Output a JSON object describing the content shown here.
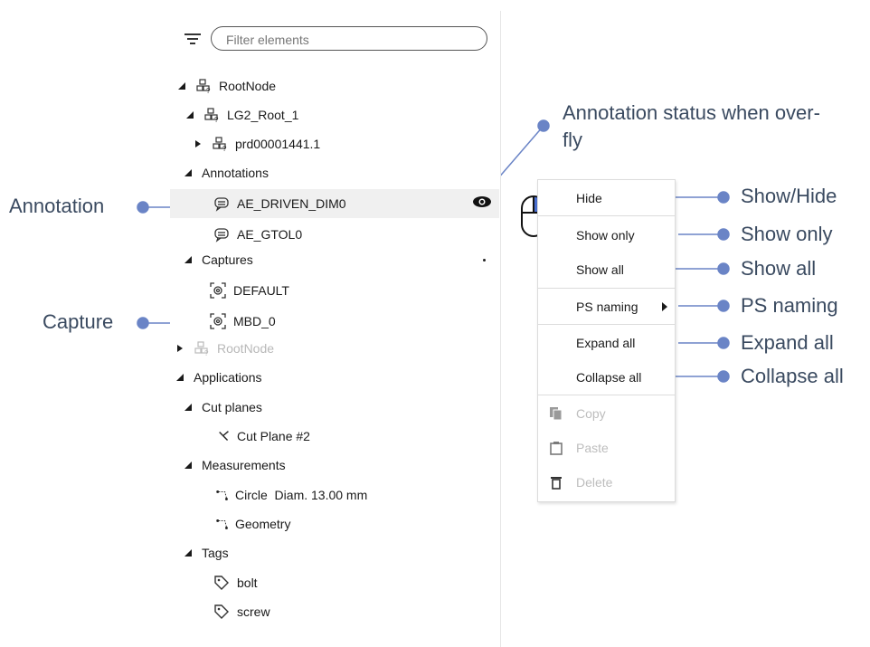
{
  "filter": {
    "placeholder": "Filter elements"
  },
  "tree": {
    "root_node": "RootNode",
    "lg2_root": "LG2_Root_1",
    "prd": "prd00001441.1",
    "annotations": "Annotations",
    "ann_driven": "AE_DRIVEN_DIM0",
    "ann_gtol": "AE_GTOL0",
    "captures": "Captures",
    "cap_default": "DEFAULT",
    "cap_mbd": "MBD_0",
    "root_node_2": "RootNode",
    "applications": "Applications",
    "cut_planes": "Cut planes",
    "cut_plane_2": "Cut Plane #2",
    "measurements": "Measurements",
    "circle_diam": "Circle  Diam. 13.00 mm",
    "geometry": "Geometry",
    "tags": "Tags",
    "tag_bolt": "bolt",
    "tag_screw": "screw"
  },
  "menu": {
    "hide": "Hide",
    "show_only": "Show only",
    "show_all": "Show all",
    "ps_naming": "PS naming",
    "expand_all": "Expand all",
    "collapse_all": "Collapse all",
    "copy": "Copy",
    "paste": "Paste",
    "delete": "Delete"
  },
  "callouts": {
    "annotation": "Annotation",
    "capture": "Capture",
    "status_line1": "Annotation status when over-",
    "status_line2": "fly",
    "show_hide": "Show/Hide",
    "show_only": "Show only",
    "show_all": "Show all",
    "ps_naming": "PS naming",
    "expand_all": "Expand all",
    "collapse_all": "Collapse all"
  },
  "colors": {
    "callout_line": "#6a84c6",
    "callout_text": "#3a4a60",
    "selected_row": "#f0f0f0"
  }
}
